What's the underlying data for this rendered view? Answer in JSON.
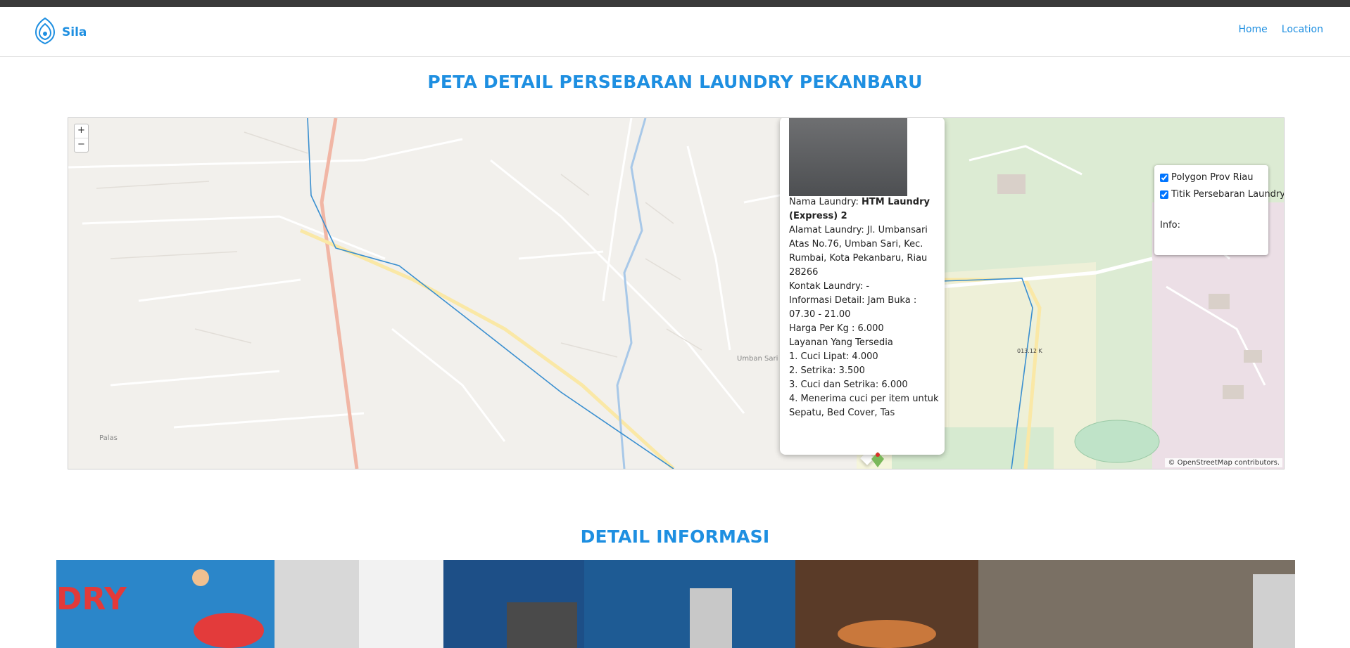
{
  "brand": {
    "name": "Sila",
    "logo_icon": "map-pin-logo-icon"
  },
  "nav": {
    "home": "Home",
    "location": "Location"
  },
  "page": {
    "map_title": "PETA DETAIL PERSEBARAN LAUNDRY PEKANBARU",
    "detail_title": "DETAIL INFORMASI"
  },
  "map": {
    "zoom_in": "+",
    "zoom_out": "−",
    "attribution": "© OpenStreetMap contributors.",
    "labels": {
      "umban_sari": "Umban Sari",
      "palas": "Palas",
      "road_ref": "013.12 K"
    },
    "popup": {
      "nama_label": "Nama Laundry: ",
      "nama_value": "HTM Laundry (Express) 2",
      "alamat": "Alamat Laundry: Jl. Umbansari Atas No.76, Umban Sari, Kec. Rumbai, Kota Pekanbaru, Riau 28266",
      "kontak": "Kontak Laundry: -",
      "info": "Informasi Detail: Jam Buka : 07.30 - 21.00",
      "harga": "Harga Per Kg : 6.000",
      "layanan_title": "Layanan Yang Tersedia",
      "layanan": [
        "1. Cuci Lipat: 4.000",
        "2. Setrika: 3.500",
        "3. Cuci dan Setrika: 6.000",
        "4. Menerima cuci per item untuk Sepatu, Bed Cover, Tas"
      ]
    },
    "layers": {
      "polygon": "Polygon Prov Riau",
      "titik": "Titik Persebaran Laundry",
      "info_label": "Info:"
    }
  },
  "photo_strip": {
    "sign_text": "DRY"
  },
  "colors": {
    "accent": "#1e8fe1",
    "topbar": "#3a3a3a"
  }
}
